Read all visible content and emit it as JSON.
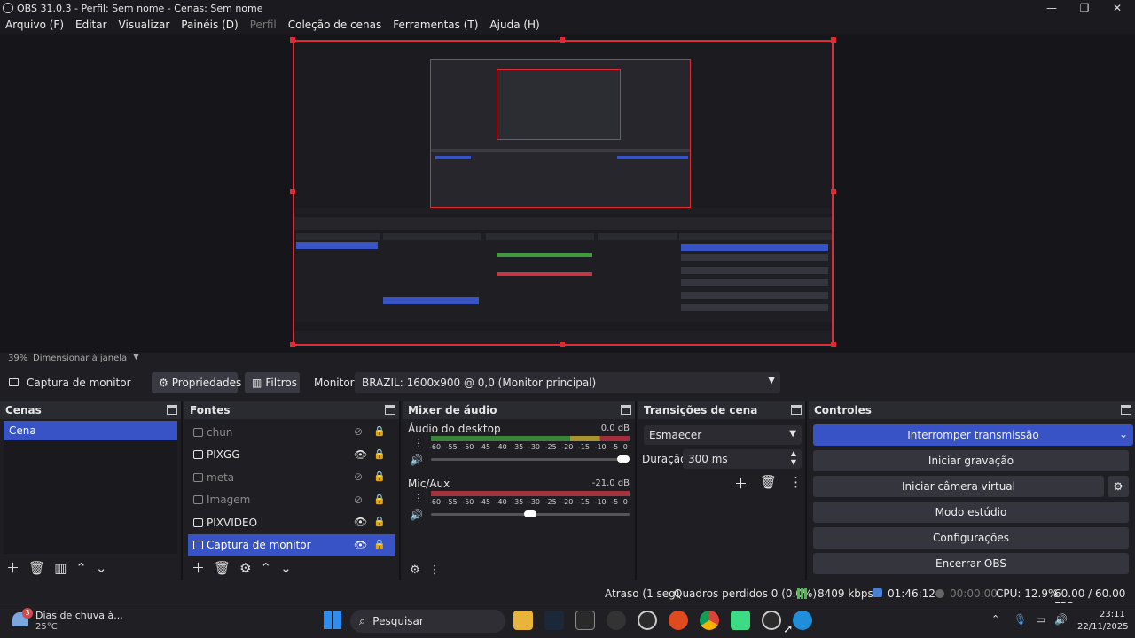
{
  "window": {
    "title": "OBS 31.0.3 - Perfil: Sem nome - Cenas: Sem nome"
  },
  "menu": [
    {
      "label": "Arquivo (F)",
      "enabled": true
    },
    {
      "label": "Editar",
      "enabled": true
    },
    {
      "label": "Visualizar",
      "enabled": true
    },
    {
      "label": "Painéis (D)",
      "enabled": true
    },
    {
      "label": "Perfil",
      "enabled": false
    },
    {
      "label": "Coleção de cenas",
      "enabled": true
    },
    {
      "label": "Ferramentas (T)",
      "enabled": true
    },
    {
      "label": "Ajuda (H)",
      "enabled": true
    }
  ],
  "preview": {
    "zoom": "39%",
    "scale_mode": "Dimensionar à janela"
  },
  "source_toolbar": {
    "selected_source": "Captura de monitor",
    "properties": "Propriedades",
    "filters": "Filtros",
    "monitor_label": "Monitor",
    "monitor_value": "BRAZIL: 1600x900 @ 0,0 (Monitor principal)"
  },
  "scenes": {
    "title": "Cenas",
    "items": [
      "Cena"
    ]
  },
  "sources": {
    "title": "Fontes",
    "items": [
      {
        "name": "chun",
        "visible": false,
        "selected": false
      },
      {
        "name": "PIXGG",
        "visible": true,
        "selected": false
      },
      {
        "name": "meta",
        "visible": false,
        "selected": false
      },
      {
        "name": "Imagem",
        "visible": false,
        "selected": false
      },
      {
        "name": "PIXVIDEO",
        "visible": true,
        "selected": false
      },
      {
        "name": "Captura de monitor",
        "visible": true,
        "selected": true
      }
    ]
  },
  "mixer": {
    "title": "Mixer de áudio",
    "scale": [
      "-60",
      "-55",
      "-50",
      "-45",
      "-40",
      "-35",
      "-30",
      "-25",
      "-20",
      "-15",
      "-10",
      "-5",
      "0"
    ],
    "channels": [
      {
        "name": "Áudio do desktop",
        "db": "0.0 dB",
        "volume": 1.0,
        "active": true
      },
      {
        "name": "Mic/Aux",
        "db": "-21.0 dB",
        "volume": 0.5,
        "active": false
      }
    ]
  },
  "transitions": {
    "title": "Transições de cena",
    "selected": "Esmaecer",
    "duration_label": "Duração",
    "duration_value": "300 ms"
  },
  "controls": {
    "title": "Controles",
    "stream": "Interromper transmissão",
    "record": "Iniciar gravação",
    "virtual_cam": "Iniciar câmera virtual",
    "studio": "Modo estúdio",
    "settings": "Configurações",
    "exit": "Encerrar OBS",
    "accent": "#3753c5"
  },
  "status": {
    "delay": "Atraso (1 seg)",
    "dropped": "Quadros perdidos 0 (0.0%)",
    "bitrate": "8409 kbps",
    "stream_time": "01:46:12",
    "rec_time": "00:00:00",
    "cpu": "CPU: 12.9%",
    "fps": "60.00 / 60.00 FPS"
  },
  "taskbar": {
    "weather": "Dias de chuva à...",
    "temp": "25°C",
    "weather_badge": "3",
    "search": "Pesquisar",
    "time": "23:11",
    "date": "22/11/2025"
  }
}
